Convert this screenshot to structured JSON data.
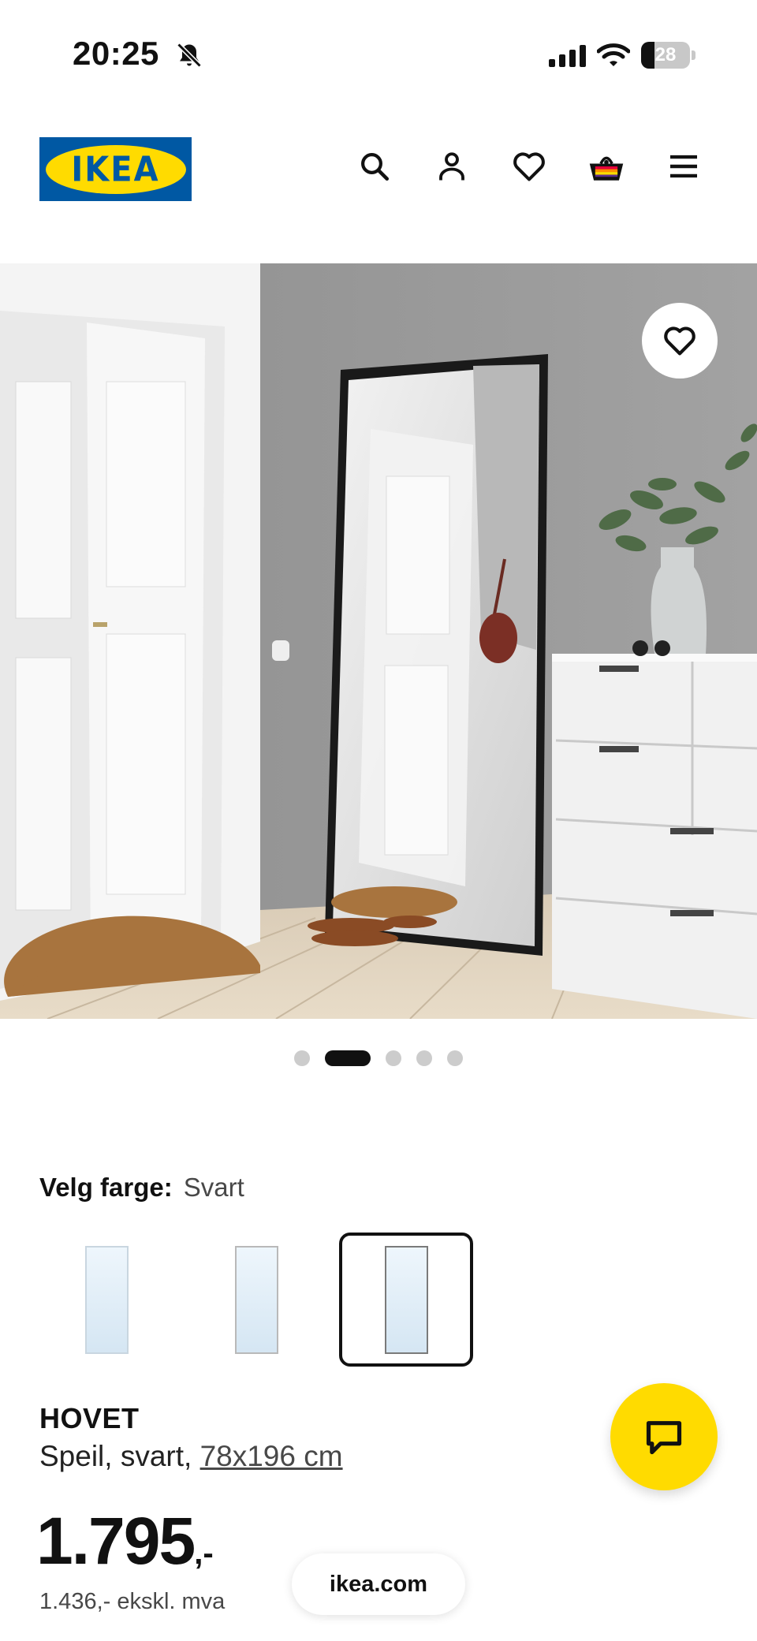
{
  "status_bar": {
    "time": "20:25",
    "battery": "28",
    "battery_level": 0.28
  },
  "header": {
    "logo_text": "IKEA",
    "icons": [
      "search-icon",
      "account-icon",
      "heart-icon",
      "basket-icon",
      "menu-icon"
    ]
  },
  "gallery": {
    "image_count": 5,
    "active_index": 1
  },
  "color_picker": {
    "label": "Velg farge:",
    "selected": "Svart",
    "options_count": 3,
    "selected_index": 2
  },
  "product": {
    "name": "HOVET",
    "description": "Speil, svart, ",
    "size": "78x196 cm",
    "price_main": "1.795",
    "price_suffix": ",-",
    "price_ex_vat": "1.436,- ekskl. mva"
  },
  "browser": {
    "url": "ikea.com"
  },
  "colors": {
    "ikea_blue": "#0058a3",
    "ikea_yellow": "#ffdb00"
  }
}
